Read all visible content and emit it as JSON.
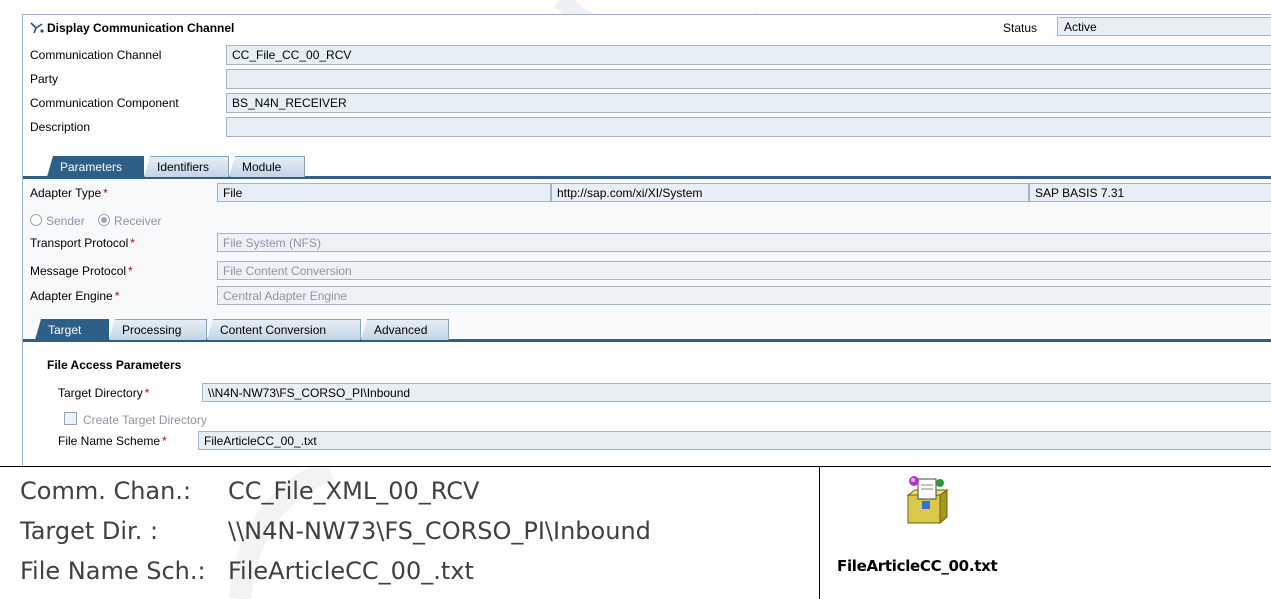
{
  "header": {
    "title": "Display Communication Channel",
    "status_label": "Status",
    "status_value": "Active"
  },
  "channel": [
    {
      "label": "Communication Channel",
      "value": "CC_File_CC_00_RCV"
    },
    {
      "label": "Party",
      "value": ""
    },
    {
      "label": "Communication Component",
      "value": "BS_N4N_RECEIVER"
    },
    {
      "label": "Description",
      "value": ""
    }
  ],
  "main_tabs": [
    "Parameters",
    "Identifiers",
    "Module"
  ],
  "adapter": {
    "type_label": "Adapter Type",
    "type_value": "File",
    "namespace": "http://sap.com/xi/XI/System",
    "release": "SAP BASIS 7.31",
    "sender_label": "Sender",
    "receiver_label": "Receiver",
    "transport_label": "Transport Protocol",
    "transport_value": "File System (NFS)",
    "message_label": "Message Protocol",
    "message_value": "File Content Conversion",
    "engine_label": "Adapter Engine",
    "engine_value": "Central Adapter Engine"
  },
  "sub_tabs": [
    "Target",
    "Processing",
    "Content Conversion",
    "Advanced"
  ],
  "file_access": {
    "section_title": "File Access Parameters",
    "target_dir_label": "Target Directory",
    "target_dir_value": "\\\\N4N-NW73\\FS_CORSO_PI\\Inbound",
    "create_dir_label": "Create Target Directory",
    "file_scheme_label": "File Name Scheme",
    "file_scheme_value": "FileArticleCC_00_.txt"
  },
  "required_mark": "*",
  "summary": [
    {
      "key": "Comm. Chan.:",
      "value": "CC_File_XML_00_RCV"
    },
    {
      "key": "Target Dir. :",
      "value": "\\\\N4N-NW73\\FS_CORSO_PI\\Inbound"
    },
    {
      "key": "File Name Sch.:",
      "value": "FileArticleCC_00_.txt"
    }
  ],
  "output_file": {
    "icon": "archive-file-icon",
    "name": "FileArticleCC_00.txt"
  },
  "colors": {
    "tab_active": "#2e5f86",
    "field_bg": "#e8eef6",
    "required": "#d40000"
  }
}
